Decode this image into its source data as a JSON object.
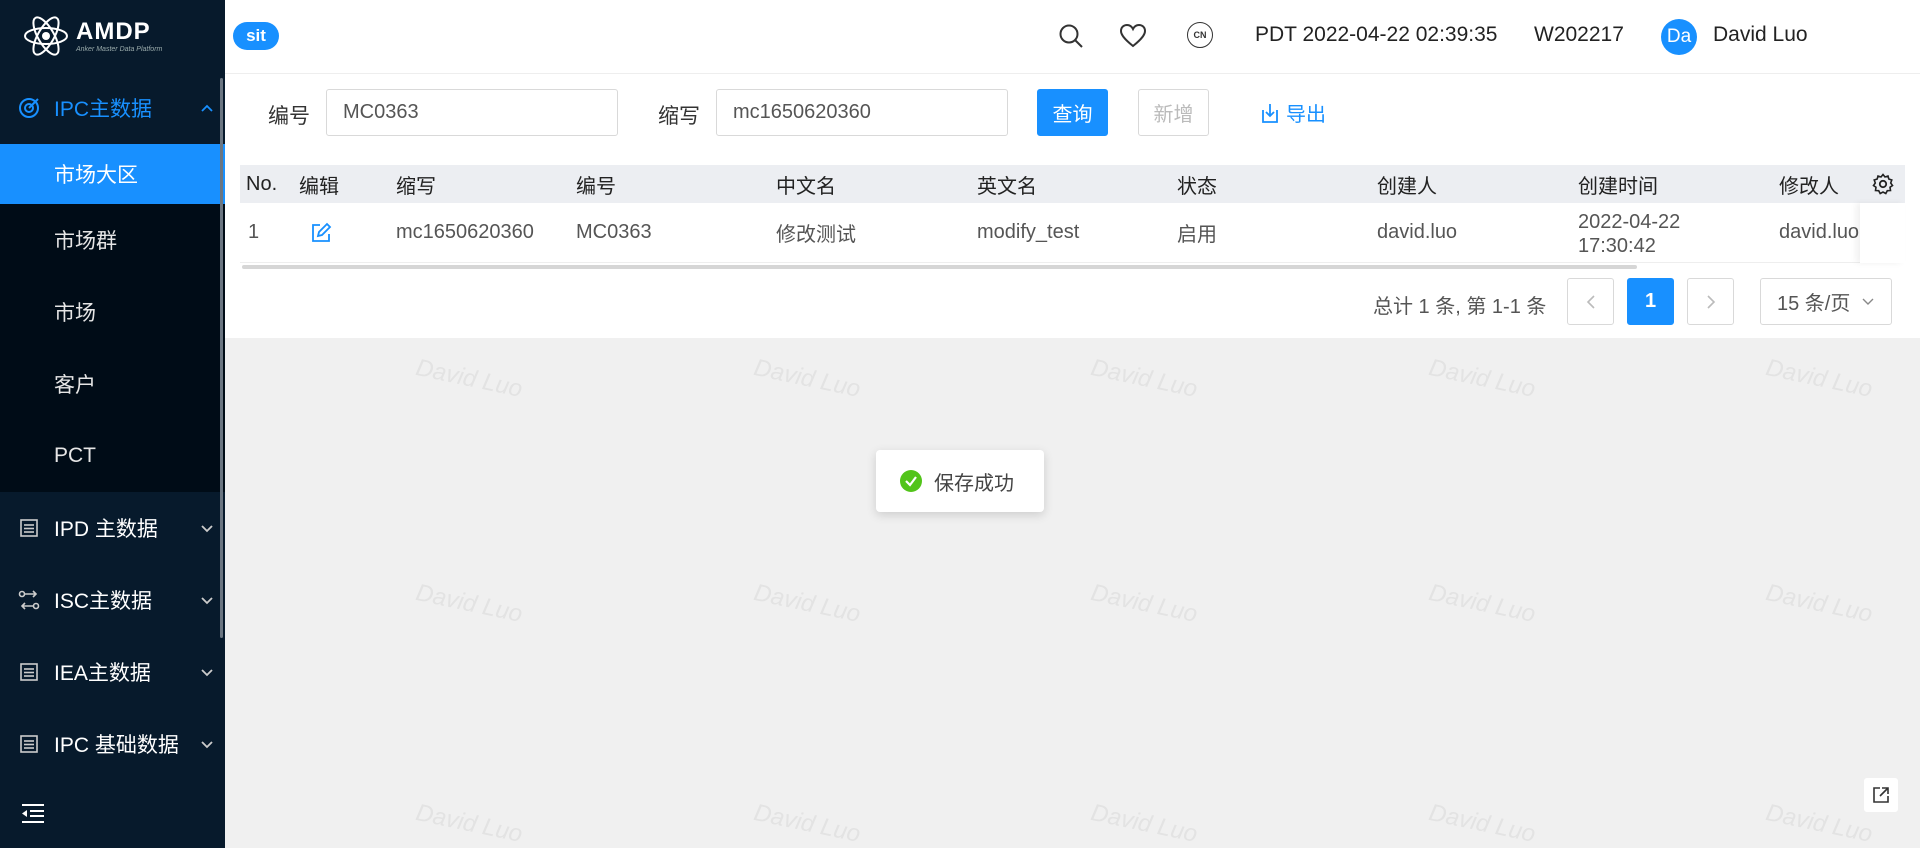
{
  "brand": {
    "title": "AMDP",
    "subtitle": "Anker Master Data Platform"
  },
  "header": {
    "env": "sit",
    "datetime": "PDT 2022-04-22 02:39:35",
    "week": "W202217",
    "lang_badge": "CN",
    "avatar_initials": "Da",
    "user_name": "David Luo"
  },
  "sidebar": {
    "groups": [
      {
        "label": "IPC主数据",
        "icon": "target-icon",
        "expanded": true,
        "items": [
          "市场大区",
          "市场群",
          "市场",
          "客户",
          "PCT"
        ],
        "selected": "市场大区"
      },
      {
        "label": "IPD 主数据",
        "icon": "document-icon"
      },
      {
        "label": "ISC主数据",
        "icon": "swap-icon"
      },
      {
        "label": "IEA主数据",
        "icon": "document-icon"
      },
      {
        "label": "IPC 基础数据",
        "icon": "document-icon"
      }
    ]
  },
  "filters": {
    "code_label": "编号",
    "code_value": "MC0363",
    "abbr_label": "缩写",
    "abbr_value": "mc1650620360",
    "query_label": "查询",
    "add_label": "新增",
    "export_label": "导出"
  },
  "table": {
    "columns": [
      "No.",
      "编辑",
      "缩写",
      "编号",
      "中文名",
      "英文名",
      "状态",
      "创建人",
      "创建时间",
      "修改人"
    ],
    "rows": [
      {
        "no": "1",
        "abbr": "mc1650620360",
        "code": "MC0363",
        "cn_name": "修改测试",
        "en_name": "modify_test",
        "status": "启用",
        "creator": "david.luo",
        "created_date": "2022-04-22",
        "created_time": "17:30:42",
        "modifier": "david.luo"
      }
    ]
  },
  "pagination": {
    "summary": "总计 1 条, 第 1-1 条",
    "current": "1",
    "page_size": "15 条/页"
  },
  "toast": {
    "message": "保存成功"
  },
  "watermark": "David Luo",
  "colors": {
    "primary": "#1890ff",
    "sidebar": "#071a2c",
    "success": "#52c41a"
  }
}
